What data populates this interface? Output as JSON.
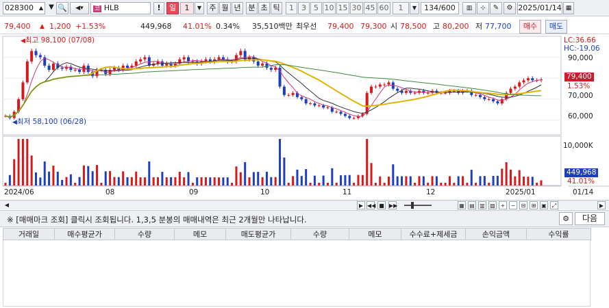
{
  "toolbar": {
    "code": "028300",
    "stock_name": "HLB",
    "period_day": "일",
    "period_count": "1",
    "week": "주",
    "month": "월",
    "year": "년",
    "minute": "분",
    "second": "초",
    "tick": "틱",
    "minute_presets": [
      "1",
      "3",
      "5",
      "10",
      "15",
      "30",
      "45",
      "60"
    ],
    "bar_count": "1",
    "range": "134/600",
    "date": "2025/01/14"
  },
  "quote": {
    "price": "79,400",
    "change": "1,200",
    "change_pct": "+1.53%",
    "volume": "449,968",
    "turnover_ratio": "41.01%",
    "ratio2": "0.34%",
    "amount": "35,510백만",
    "broker": "최우선",
    "ask": "79,400",
    "bid": "79,300",
    "open_label": "시",
    "open": "78,500",
    "high_label": "고",
    "high": "80,200",
    "low_label": "저",
    "low": "77,700",
    "buy_label": "매수",
    "sell_label": "매도"
  },
  "labels": {
    "high_marker": "최고 98,100 (07/08)",
    "low_marker": "최저 58,100 (06/28)",
    "lc": "LC:36.66",
    "hc": "HC:-19.06",
    "y_ticks": [
      "90,000",
      "80,000",
      "70,000",
      "60,000"
    ],
    "price_tag": "79,400",
    "pct_tag": "1.53%",
    "vol_tick": "10,000K",
    "vol_tag": "449,968",
    "vol_pct": "41.01%",
    "x_dates": [
      "2024/06",
      "08",
      "09",
      "10",
      "11",
      "12",
      "2025/01"
    ],
    "right_date": "01/14"
  },
  "memo": {
    "text": "※ [매매마크 조회] 클릭시 조회됩니다. 1,3,5 분봉의 매매내역은 최근 2개월만 나타납니다.",
    "next": "다음"
  },
  "table": {
    "headers": [
      "거래일",
      "매수평균가",
      "수량",
      "메모",
      "매도평균가",
      "수량",
      "메모",
      "수수료+제세금",
      "손익금액",
      "수익률"
    ]
  },
  "colors": {
    "up": "#d7191c",
    "down": "#1d3fbf",
    "ma_yellow": "#e0b400",
    "ma_green": "#3d8a3d"
  },
  "chart_data": {
    "type": "candlestick",
    "closes": [
      62000,
      61000,
      64000,
      70000,
      78000,
      88000,
      93000,
      91000,
      90000,
      86000,
      84000,
      87000,
      85000,
      84500,
      85500,
      84000,
      84000,
      83000,
      86000,
      83000,
      81000,
      84000,
      84000,
      82000,
      84000,
      85000,
      84000,
      86000,
      85000,
      86000,
      88000,
      89000,
      90000,
      86000,
      87000,
      88000,
      86000,
      87000,
      86000,
      87000,
      89000,
      90000,
      88000,
      88000,
      87000,
      88000,
      89000,
      88000,
      89000,
      90000,
      89000,
      88000,
      88000,
      91000,
      93000,
      89000,
      90000,
      88000,
      86000,
      87000,
      85000,
      84000,
      85000,
      76000,
      72000,
      72000,
      73000,
      71000,
      70000,
      68000,
      68000,
      67000,
      67000,
      66000,
      66000,
      64000,
      64000,
      63000,
      62000,
      61000,
      61000,
      62000,
      63000,
      73000,
      76000,
      76000,
      77000,
      77000,
      78000,
      75000,
      74000,
      73000,
      74000,
      73000,
      73000,
      74000,
      73000,
      73000,
      74000,
      73000,
      73000,
      73000,
      74000,
      74000,
      73000,
      74000,
      74000,
      72000,
      72000,
      71000,
      70000,
      70000,
      69000,
      68000,
      70000,
      73000,
      75000,
      76000,
      78000,
      79000,
      80000,
      79000,
      79000,
      79400
    ],
    "ylim": [
      53000,
      100000
    ],
    "volume_max_k": 12000
  }
}
